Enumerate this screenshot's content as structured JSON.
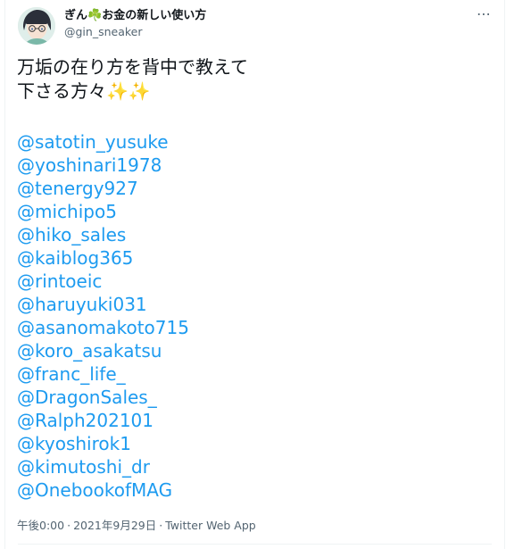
{
  "author": {
    "display_name_prefix": "ぎん",
    "clover": "☘️",
    "display_name_suffix": "お金の新しい使い方",
    "username": "@gin_sneaker",
    "more_icon": "⋯"
  },
  "tweet": {
    "line1": "万垢の在り方を背中で教えて",
    "line2_text": "下さる方々",
    "sparkles": "✨✨",
    "mentions": [
      "@satotin_yusuke",
      "@yoshinari1978",
      "@tenergy927",
      "@michipo5",
      "@hiko_sales",
      "@kaiblog365",
      "@rintoeic",
      "@haruyuki031",
      "@asanomakoto715",
      "@koro_asakatsu",
      "@franc_life_",
      "@DragonSales_",
      "@Ralph202101",
      "@kyoshirok1",
      "@kimutoshi_dr",
      "@OnebookofMAG"
    ]
  },
  "meta": {
    "time": "午後0:00",
    "separator": "·",
    "date": "2021年9月29日",
    "app": "Twitter Web App"
  },
  "colors": {
    "link": "#1d9bf0",
    "text": "#0f1419",
    "secondary": "#536471"
  }
}
